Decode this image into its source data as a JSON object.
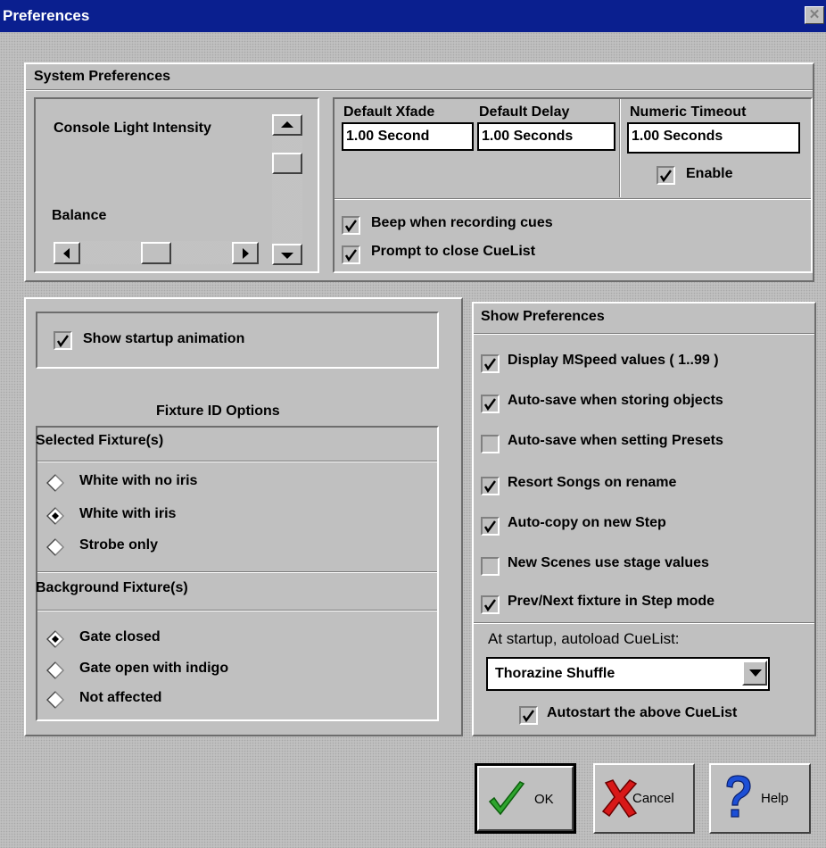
{
  "window": {
    "title": "Preferences"
  },
  "system": {
    "title": "System Preferences",
    "console_light_label": "Console Light Intensity",
    "balance_label": "Balance",
    "default_xfade_label": "Default Xfade",
    "default_xfade_value": "1.00 Second",
    "default_delay_label": "Default Delay",
    "default_delay_value": "1.00 Seconds",
    "numeric_timeout_label": "Numeric Timeout",
    "numeric_timeout_value": "1.00 Seconds",
    "enable_label": "Enable",
    "enable_checked": true,
    "beep_label": "Beep when recording cues",
    "beep_checked": true,
    "prompt_close_label": "Prompt to close CueList",
    "prompt_close_checked": true,
    "console_light_level": 0.2,
    "balance_level": 0.5
  },
  "startup": {
    "show_animation_label": "Show startup animation",
    "show_animation_checked": true
  },
  "fixture_id": {
    "title": "Fixture ID Options",
    "selected_title": "Selected Fixture(s)",
    "selected_options": [
      "White with no iris",
      "White with iris",
      "Strobe only"
    ],
    "selected_value": "White with iris",
    "background_title": "Background Fixture(s)",
    "background_options": [
      "Gate closed",
      "Gate open with indigo",
      "Not affected"
    ],
    "background_value": "Gate closed"
  },
  "show": {
    "title": "Show Preferences",
    "items": [
      {
        "label": "Display MSpeed values ( 1..99 )",
        "checked": true
      },
      {
        "label": "Auto-save when storing objects",
        "checked": true
      },
      {
        "label": "Auto-save when setting Presets",
        "checked": false
      },
      {
        "label": "Resort Songs on rename",
        "checked": true
      },
      {
        "label": "Auto-copy on new Step",
        "checked": true
      },
      {
        "label": "New Scenes use stage values",
        "checked": false
      },
      {
        "label": "Prev/Next fixture in Step mode",
        "checked": true
      }
    ],
    "autoload_label": "At startup, autoload CueList:",
    "autoload_value": "Thorazine  Shuffle",
    "autostart_label": "Autostart the above CueList",
    "autostart_checked": true
  },
  "buttons": {
    "ok": "OK",
    "cancel": "Cancel",
    "help": "Help"
  },
  "icons": {
    "close": "close-icon",
    "ok": "checkmark-icon",
    "cancel": "x-icon",
    "help": "question-icon"
  }
}
